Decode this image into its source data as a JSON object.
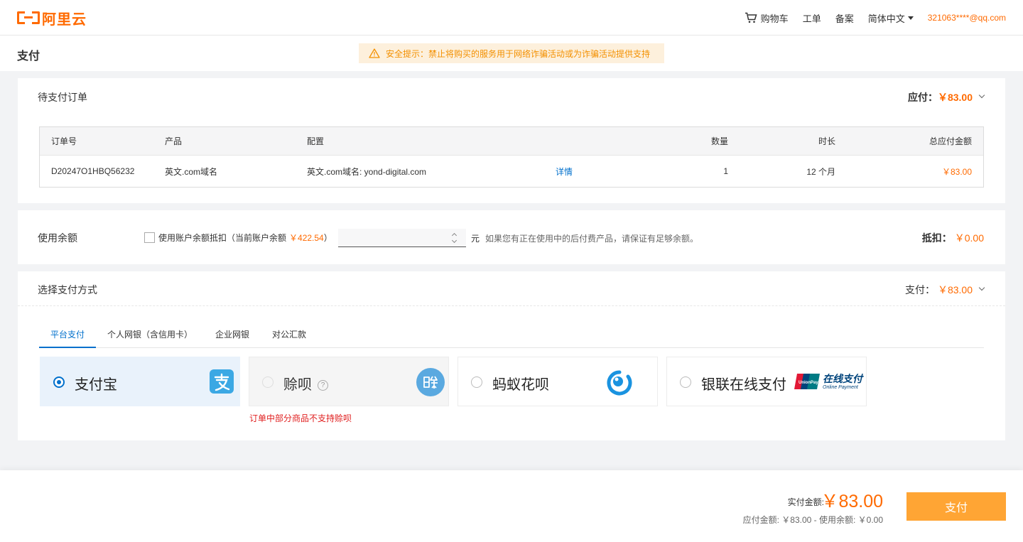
{
  "brand": {
    "name": "阿里云"
  },
  "nav": {
    "cart": "购物车",
    "ticket": "工单",
    "filing": "备案",
    "language": "简体中文",
    "account": "321063****@qq.com"
  },
  "header": {
    "title": "支付",
    "warning": "安全提示：禁止将购买的服务用于网络诈骗活动或为诈骗活动提供支持"
  },
  "order": {
    "title": "待支付订单",
    "payable_label": "应付：",
    "payable_amount": "￥83.00",
    "columns": [
      "订单号",
      "产品",
      "配置",
      "数量",
      "时长",
      "总应付金额"
    ],
    "row": {
      "order_no": "D20247O1HBQ56232",
      "product": "英文.com域名",
      "config": "英文.com域名: yond-digital.com",
      "details": "详情",
      "quantity": "1",
      "duration": "12 个月",
      "total": "￥83.00"
    }
  },
  "balance": {
    "title": "使用余额",
    "checkbox_label": "使用账户余额抵扣（当前账户余额",
    "current_balance": "￥422.54",
    "close_paren": "）",
    "input_value": "",
    "unit": "元",
    "hint": "如果您有正在使用中的后付费产品，请保证有足够余额。",
    "deduct_label": "抵扣：",
    "deduct_amount": "￥0.00"
  },
  "payment": {
    "title": "选择支付方式",
    "pay_label": "支付：",
    "pay_amount": "￥83.00",
    "tabs": [
      "平台支付",
      "个人网银（含信用卡）",
      "企业网银",
      "对公汇款"
    ],
    "options": [
      {
        "label": "支付宝",
        "icon": "alipay-icon",
        "selected": true
      },
      {
        "label": "赊呗",
        "icon": "shebei-icon",
        "disabled": true
      },
      {
        "label": "蚂蚁花呗",
        "icon": "huabei-icon"
      },
      {
        "label": "银联在线支付",
        "icon": "unionpay-icon"
      }
    ],
    "shebei_error": "订单中部分商品不支持赊呗",
    "unionpay_text": "在线支付",
    "unionpay_sub": "Online Payment"
  },
  "footer": {
    "actual_label": "实付金额:",
    "actual_amount": "￥83.00",
    "breakdown": "应付金额: ￥83.00 - 使用余额: ￥0.00",
    "pay_button": "支付"
  },
  "colors": {
    "accent": "#ff6a00",
    "link": "#0070cc",
    "button": "#ffa534",
    "error": "#e02020"
  }
}
